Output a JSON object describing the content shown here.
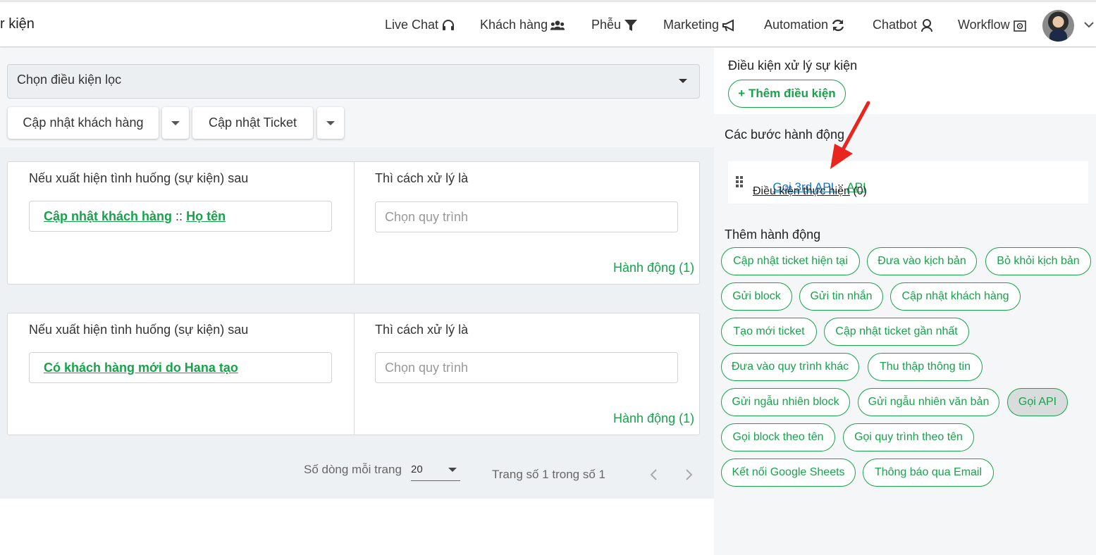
{
  "header": {
    "title": "r kiện",
    "nav": [
      {
        "label": "Live Chat",
        "icon": "headset-icon"
      },
      {
        "label": "Khách hàng",
        "icon": "users-icon"
      },
      {
        "label": "Phễu",
        "icon": "funnel-icon"
      },
      {
        "label": "Marketing",
        "icon": "megaphone-icon"
      },
      {
        "label": "Automation",
        "icon": "sync-icon"
      },
      {
        "label": "Chatbot",
        "icon": "robot-icon"
      },
      {
        "label": "Workflow",
        "icon": "workflow-icon"
      }
    ]
  },
  "filter": {
    "placeholder": "Chọn điều kiện lọc",
    "buttons": [
      "Cập nhật khách hàng",
      "Cập nhật Ticket"
    ]
  },
  "rules": [
    {
      "if_label": "Nếu xuất hiện tình huống (sự kiện) sau",
      "event_main": "Cập nhật khách hàng",
      "event_sep": "::",
      "event_sub": "Họ tên",
      "then_label": "Thì cách xử lý là",
      "process_placeholder": "Chọn quy trình",
      "action_link": "Hành động (1)"
    },
    {
      "if_label": "Nếu xuất hiện tình huống (sự kiện) sau",
      "event_main": "Có khách hàng mới do Hana tạo",
      "event_sep": "",
      "event_sub": "",
      "then_label": "Thì cách xử lý là",
      "process_placeholder": "Chọn quy trình",
      "action_link": "Hành động (1)"
    }
  ],
  "pagination": {
    "rows_label": "Số dòng mỗi trang",
    "rows_value": "20",
    "page_info": "Trang số 1 trong số 1"
  },
  "right_panel": {
    "condition_title": "Điều kiện xử lý sự kiện",
    "add_condition": "+ Thêm điều kiện",
    "steps_title": "Các bước hành động",
    "step": {
      "name": "Gọi 3rd API ",
      "sep": "::",
      "sub": "API",
      "condition_label": "Điều kiện thực hiện",
      "condition_count": "(0)"
    },
    "add_action_title": "Thêm hành động",
    "actions": [
      "Cập nhật ticket hiện tại",
      "Đưa vào kịch bản",
      "Bỏ khỏi kịch bản",
      "Gửi block",
      "Gửi tin nhắn",
      "Cập nhật khách hàng",
      "Tạo mới ticket",
      "Cập nhật ticket gần nhất",
      "Đưa vào quy trình khác",
      "Thu thập thông tin",
      "Gửi ngẫu nhiên block",
      "Gửi ngẫu nhiên văn bản",
      "Gọi API",
      "Gọi block theo tên",
      "Gọi quy trình theo tên",
      "Kết nối Google Sheets",
      "Thông báo qua Email"
    ],
    "active_action": "Gọi API"
  },
  "colors": {
    "accent": "#16a34a",
    "arrow": "#e8261f"
  }
}
